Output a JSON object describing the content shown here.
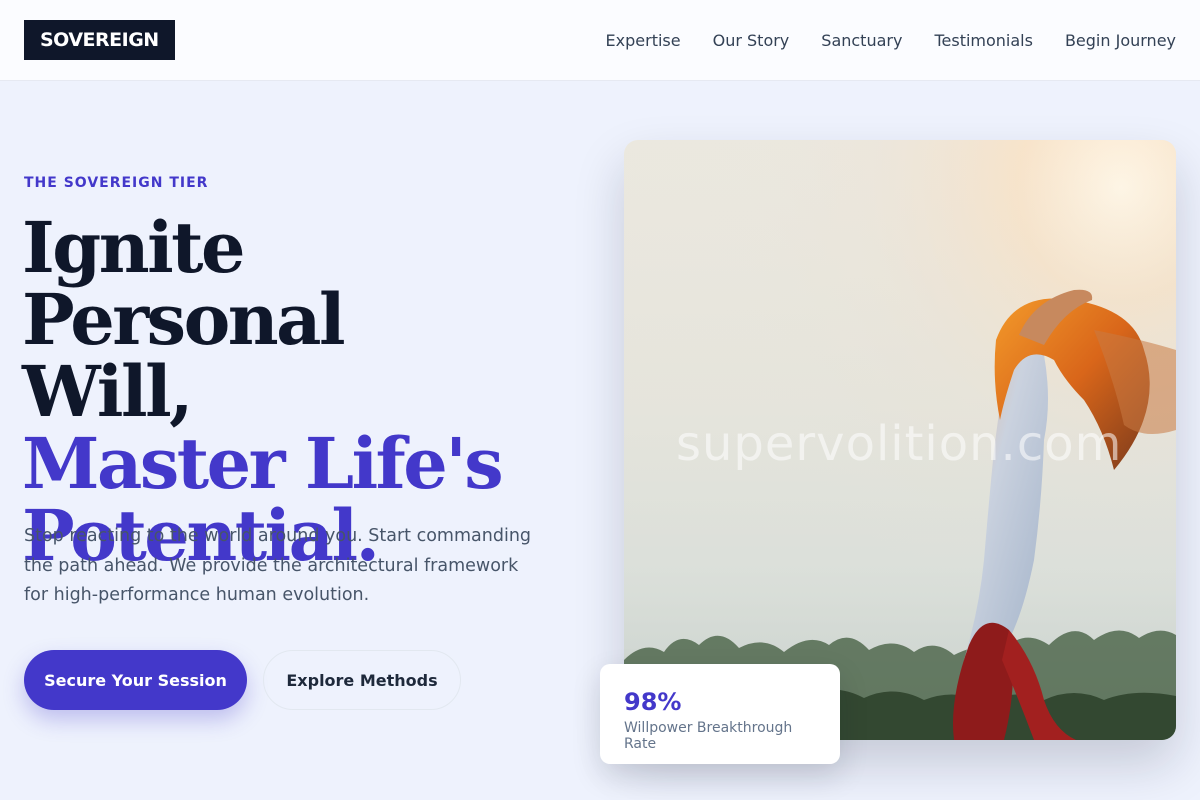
{
  "brand": {
    "logo_text": "SOVEREIGN"
  },
  "nav": {
    "items": [
      {
        "label": "Expertise"
      },
      {
        "label": "Our Story"
      },
      {
        "label": "Sanctuary"
      },
      {
        "label": "Testimonials"
      },
      {
        "label": "Begin Journey"
      }
    ]
  },
  "hero": {
    "eyebrow": "THE SOVEREIGN TIER",
    "headline_line1": "Ignite Personal",
    "headline_line2": "Will,",
    "headline_accent_line1": "Master Life's",
    "headline_accent_line2": "Potential.",
    "lede": "Stop reacting to the world around you. Start commanding the path ahead. We provide the architectural framework for high-performance human evolution.",
    "primary_cta": "Secure Your Session",
    "secondary_cta": "Explore Methods",
    "image_watermark": "supervolition.com"
  },
  "stat": {
    "value": "98%",
    "label": "Willpower Breakthrough Rate"
  },
  "colors": {
    "accent": "#4338ca",
    "ink": "#0f172a",
    "page_bg": "#eef2fd"
  }
}
